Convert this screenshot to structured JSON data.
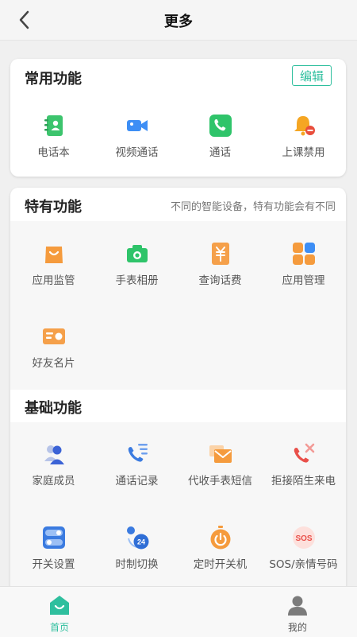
{
  "header": {
    "title": "更多"
  },
  "common": {
    "title": "常用功能",
    "edit_label": "编辑",
    "items": [
      {
        "label": "电话本",
        "icon": "phonebook-icon"
      },
      {
        "label": "视频通话",
        "icon": "video-call-icon"
      },
      {
        "label": "通话",
        "icon": "phone-icon"
      },
      {
        "label": "上课禁用",
        "icon": "class-disable-bell-icon"
      }
    ]
  },
  "special": {
    "title": "特有功能",
    "note": "不同的智能设备，特有功能会有不同",
    "items": [
      {
        "label": "应用监管",
        "icon": "app-monitor-bag-icon"
      },
      {
        "label": "手表相册",
        "icon": "camera-icon"
      },
      {
        "label": "查询话费",
        "icon": "bill-yuan-icon"
      },
      {
        "label": "应用管理",
        "icon": "app-grid-icon"
      },
      {
        "label": "好友名片",
        "icon": "contact-card-icon"
      }
    ]
  },
  "basic": {
    "title": "基础功能",
    "items": [
      {
        "label": "家庭成员",
        "icon": "family-members-icon"
      },
      {
        "label": "通话记录",
        "icon": "call-log-icon"
      },
      {
        "label": "代收手表短信",
        "icon": "sms-envelope-icon"
      },
      {
        "label": "拒接陌生来电",
        "icon": "reject-call-icon"
      },
      {
        "label": "开关设置",
        "icon": "toggle-switch-icon"
      },
      {
        "label": "时制切换",
        "icon": "time-format-24-icon",
        "badge": "24"
      },
      {
        "label": "定时开关机",
        "icon": "timer-power-icon"
      },
      {
        "label": "SOS/亲情号码",
        "icon": "sos-icon",
        "badge": "SOS"
      }
    ]
  },
  "tabbar": {
    "items": [
      {
        "label": "首页",
        "active": true
      },
      {
        "label": "我的",
        "active": false
      }
    ],
    "active_color": "#2fbf9e"
  }
}
